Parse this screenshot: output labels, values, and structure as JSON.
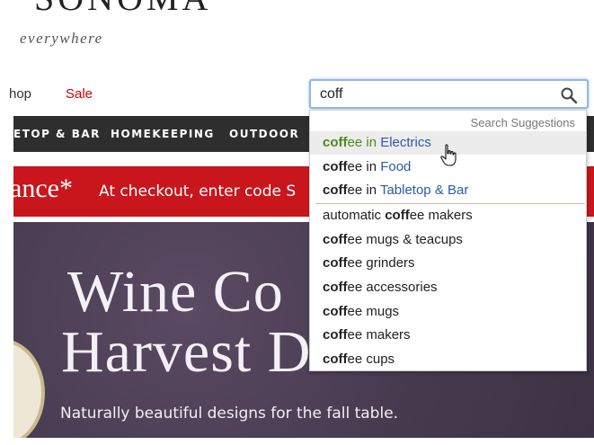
{
  "brand": {
    "logo": "SONOMA",
    "tagline": "everywhere"
  },
  "utility_nav": {
    "shop": "hop",
    "sale": "Sale"
  },
  "main_nav": {
    "items": [
      "ETOP & BAR",
      "HOMEKEEPING",
      "OUTDOOR"
    ]
  },
  "promo": {
    "big": "ance*",
    "small": "At checkout, enter code S"
  },
  "hero": {
    "line1": "Wine Co",
    "line2": "Harvest D",
    "subtitle": "Naturally beautiful designs for the fall table."
  },
  "search": {
    "value": "coff",
    "icon": "search-icon"
  },
  "suggestions": {
    "heading": "Search Suggestions",
    "category_items": [
      {
        "query": "coff",
        "rest": "ee",
        "in": " in ",
        "category": "Electrics"
      },
      {
        "query": "coff",
        "rest": "ee",
        "in": " in ",
        "category": "Food"
      },
      {
        "query": "coff",
        "rest": "ee",
        "in": " in ",
        "category": "Tabletop & Bar"
      }
    ],
    "term_items": [
      {
        "pre": "automatic ",
        "query": "coff",
        "rest": "ee makers"
      },
      {
        "pre": "",
        "query": "coff",
        "rest": "ee mugs & teacups"
      },
      {
        "pre": "",
        "query": "coff",
        "rest": "ee grinders"
      },
      {
        "pre": "",
        "query": "coff",
        "rest": "ee accessories"
      },
      {
        "pre": "",
        "query": "coff",
        "rest": "ee mugs"
      },
      {
        "pre": "",
        "query": "coff",
        "rest": "ee makers"
      },
      {
        "pre": "",
        "query": "coff",
        "rest": "ee cups"
      }
    ]
  },
  "colors": {
    "sale": "#cc0000",
    "nav_bg": "#2e2e2e",
    "promo_bg": "#c8161c",
    "hero_bg": "#4b3d52",
    "highlight_text": "#4b8b16",
    "category_link": "#2a5ca8",
    "search_focus": "#8fb7e6"
  }
}
